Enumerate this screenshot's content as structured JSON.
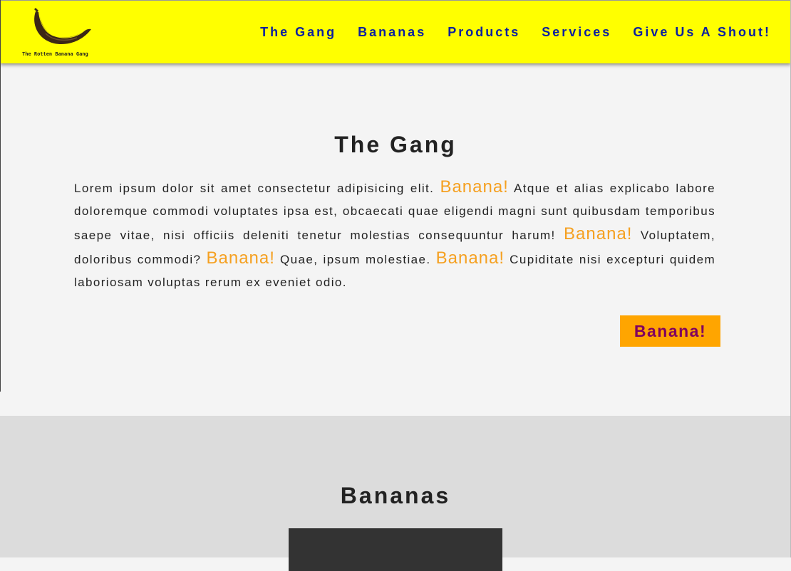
{
  "logo": {
    "text": "The Rotten Banana Gang"
  },
  "nav": {
    "items": [
      "The Gang",
      "Bananas",
      "Products",
      "Services",
      "Give Us A Shout!"
    ]
  },
  "gang": {
    "title": "The Gang",
    "text1": "Lorem ipsum dolor sit amet consectetur adipisicing elit. ",
    "hl1": "Banana!",
    "text2": " Atque et alias explicabo labore doloremque commodi voluptates ipsa est, obcaecati quae eligendi magni sunt quibusdam temporibus saepe vitae, nisi officiis deleniti tenetur molestias consequuntur harum! ",
    "hl2": "Banana!",
    "text3": " Voluptatem, doloribus commodi? ",
    "hl3": "Banana!",
    "text4": " Quae, ipsum molestiae. ",
    "hl4": "Banana!",
    "text5": " Cupiditate nisi excepturi quidem laboriosam voluptas rerum ex eveniet odio.",
    "button_label": "Banana!"
  },
  "bananas": {
    "title": "Bananas"
  },
  "colors": {
    "header_bg": "#ffff00",
    "nav_link": "#0a1fa0",
    "highlight": "#f5a020",
    "button_bg": "#ffa500",
    "button_text": "#800060",
    "section_bg": "#f4f4f4",
    "section_alt_bg": "#dcdcdc"
  }
}
